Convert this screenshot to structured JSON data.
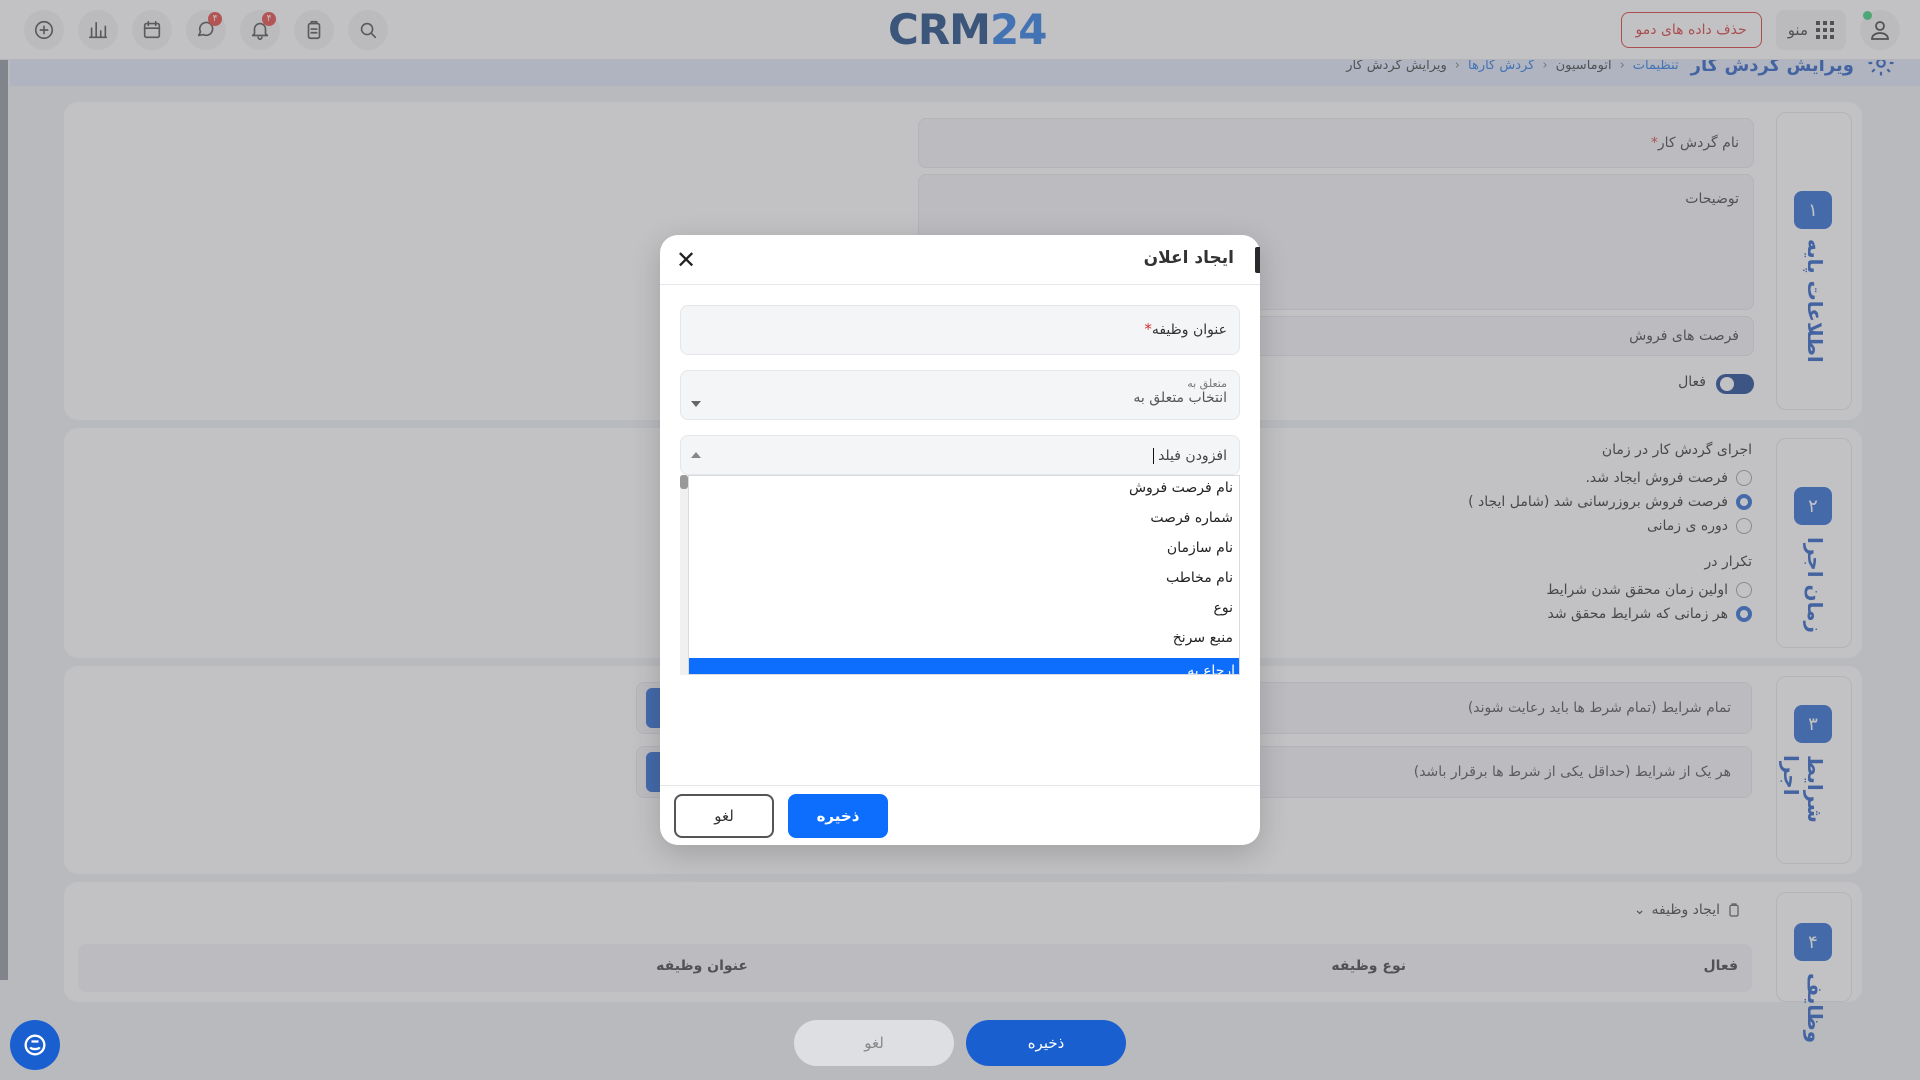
{
  "header": {
    "logo_text": "CRM",
    "logo_num": "24",
    "menu_label": "منو",
    "demo_button": "حذف داده های دمو",
    "chat_badge": "۴",
    "bell_badge": "۴"
  },
  "breadcrumb": {
    "title": "ویرایش گردش کار",
    "items": [
      "تنظیمات",
      "اتوماسیون",
      "گردش کارها",
      "ویرایش گردش کار"
    ]
  },
  "section1": {
    "step": "۱",
    "label": "اطلاعات پایه",
    "name_label": "نام گردش کار",
    "desc_label": "توضیحات",
    "module_value": "فرصت های فروش",
    "active_label": "فعال"
  },
  "section2": {
    "step": "۲",
    "label": "زمان اجرا",
    "run_title": "اجرای گردش کار در زمان",
    "run_options": [
      "فرصت فروش ایجاد شد.",
      "فرصت فروش بروزرسانی شد (شامل ایجاد )",
      "دوره ی زمانی"
    ],
    "repeat_title": "تکرار در",
    "repeat_options": [
      "اولین زمان محقق شدن شرایط",
      "هر زمانی که شرایط محقق شد"
    ]
  },
  "section3": {
    "step": "۳",
    "label": "شرایط اجرا",
    "all_conditions": "تمام شرایط (تمام شرط ها باید رعایت شوند)",
    "any_conditions": "هر یک از شرایط (حداقل یکی از شرط ها برقرار باشد)"
  },
  "section4": {
    "step": "۴",
    "label": "وظایف",
    "create_task": "ایجاد وظیفه",
    "columns": [
      "فعال",
      "نوع وظیفه",
      "عنوان وظیفه"
    ]
  },
  "bottom": {
    "save": "ذخیره",
    "cancel": "لغو"
  },
  "modal": {
    "title": "ایجاد اعلان",
    "task_title_label": "عنوان وظیفه",
    "related_small": "متعلق به",
    "related_placeholder": "انتخاب متعلق به",
    "add_field_label": "افزودن فیلد",
    "options": [
      "نام فرصت فروش",
      "شماره فرصت",
      "نام سازمان",
      "نام مخاطب",
      "نوع",
      "منبع سرنخ"
    ],
    "selected_option": "ارجاع به",
    "save": "ذخیره",
    "cancel": "لغو"
  },
  "colors": {
    "primary": "#1a5fd0",
    "selected": "#0d6efd",
    "danger": "#d32f2f"
  }
}
